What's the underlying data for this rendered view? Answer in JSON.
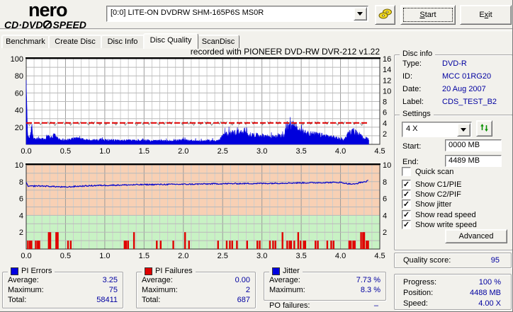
{
  "toolbar": {
    "logo_top": "nero",
    "logo_bottom_left": "CD·DVD",
    "logo_bottom_right": "SPEED",
    "drive": "[0:0]  LITE-ON DVDRW SHM-165P6S MS0R",
    "start_label": "Start",
    "exit_label": "Exit"
  },
  "tabs": {
    "items": [
      "Benchmark",
      "Create Disc",
      "Disc Info",
      "Disc Quality",
      "ScanDisc"
    ],
    "active_index": 3
  },
  "disc_info": {
    "title": "Disc info",
    "rows": [
      {
        "label": "Type:",
        "value": "DVD-R"
      },
      {
        "label": "ID:",
        "value": "MCC 01RG20"
      },
      {
        "label": "Date:",
        "value": "20 Aug 2007"
      },
      {
        "label": "Label:",
        "value": "CDS_TEST_B2"
      }
    ]
  },
  "settings": {
    "title": "Settings",
    "speed_value": "4 X",
    "start_label": "Start:",
    "start_value": "0000 MB",
    "end_label": "End:",
    "end_value": "4489 MB",
    "checkboxes": [
      {
        "label": "Quick scan",
        "checked": false
      },
      {
        "label": "Show C1/PIE",
        "checked": true
      },
      {
        "label": "Show C2/PIF",
        "checked": true
      },
      {
        "label": "Show jitter",
        "checked": true
      },
      {
        "label": "Show read speed",
        "checked": true
      },
      {
        "label": "Show write speed",
        "checked": true
      }
    ],
    "advanced_label": "Advanced"
  },
  "quality": {
    "label": "Quality score:",
    "value": "95"
  },
  "progress": {
    "rows": [
      {
        "label": "Progress:",
        "value": "100 %"
      },
      {
        "label": "Position:",
        "value": "4488 MB"
      },
      {
        "label": "Speed:",
        "value": "4.00 X"
      }
    ]
  },
  "stats": {
    "pi_errors": {
      "title": "PI Errors",
      "color": "#0000e0",
      "rows": [
        {
          "label": "Average:",
          "value": "3.25"
        },
        {
          "label": "Maximum:",
          "value": "75"
        },
        {
          "label": "Total:",
          "value": "58411"
        }
      ]
    },
    "pi_failures": {
      "title": "PI Failures",
      "color": "#e00000",
      "rows": [
        {
          "label": "Average:",
          "value": "0.00"
        },
        {
          "label": "Maximum:",
          "value": "2"
        },
        {
          "label": "Total:",
          "value": "687"
        }
      ]
    },
    "jitter": {
      "title": "Jitter",
      "color": "#0000e0",
      "rows": [
        {
          "label": "Average:",
          "value": "7.73 %"
        },
        {
          "label": "Maximum:",
          "value": "8.3 %"
        }
      ]
    },
    "po_failures": {
      "label": "PO failures:",
      "value": "–"
    }
  },
  "chart_data": [
    {
      "type": "area",
      "title": "recorded with PIONEER DVD-RW  DVR-212  v1.22",
      "x": {
        "min": 0,
        "max": 4.5,
        "ticks": [
          "0.0",
          "0.5",
          "1.0",
          "1.5",
          "2.0",
          "2.5",
          "3.0",
          "3.5",
          "4.0",
          "4.5"
        ],
        "minor_step": 0.1,
        "data_end": 4.36
      },
      "y_left": {
        "label": "PI Errors",
        "min": 0,
        "max": 100,
        "ticks": [
          "100",
          "80",
          "60",
          "40",
          "20"
        ],
        "grid_step": 10
      },
      "y_right": {
        "label": "Speed (X)",
        "min": 0,
        "max": 16,
        "ticks": [
          "16",
          "14",
          "12",
          "10",
          "8",
          "6",
          "4",
          "2"
        ]
      },
      "series": [
        {
          "name": "PI Errors",
          "style": "filled-noise",
          "color": "#0000dc",
          "axis": "left",
          "anchors": [
            [
              0,
              75
            ],
            [
              0.01,
              40
            ],
            [
              0.02,
              9
            ],
            [
              0.05,
              8
            ],
            [
              0.07,
              24
            ],
            [
              0.09,
              8
            ],
            [
              0.15,
              6
            ],
            [
              0.25,
              6
            ],
            [
              0.28,
              13
            ],
            [
              0.31,
              7
            ],
            [
              0.36,
              11
            ],
            [
              0.4,
              6
            ],
            [
              0.5,
              5
            ],
            [
              0.65,
              7
            ],
            [
              0.8,
              5
            ],
            [
              1.0,
              5
            ],
            [
              1.2,
              4.5
            ],
            [
              1.5,
              4.5
            ],
            [
              1.8,
              4
            ],
            [
              2.0,
              5
            ],
            [
              2.2,
              4
            ],
            [
              2.45,
              4.5
            ],
            [
              2.52,
              11
            ],
            [
              2.6,
              13
            ],
            [
              2.7,
              14
            ],
            [
              2.85,
              11
            ],
            [
              3.0,
              10
            ],
            [
              3.15,
              8.5
            ],
            [
              3.28,
              10
            ],
            [
              3.32,
              20
            ],
            [
              3.38,
              23
            ],
            [
              3.45,
              18
            ],
            [
              3.55,
              13
            ],
            [
              3.65,
              12
            ],
            [
              3.8,
              10
            ],
            [
              3.95,
              7.5
            ],
            [
              4.05,
              5
            ],
            [
              4.1,
              13
            ],
            [
              4.17,
              15
            ],
            [
              4.22,
              12
            ],
            [
              4.28,
              8
            ],
            [
              4.33,
              7
            ],
            [
              4.36,
              6
            ]
          ]
        },
        {
          "name": "Write Speed",
          "style": "dashed-line",
          "color": "#e00000",
          "axis": "right",
          "value": 4.0
        },
        {
          "name": "Read Speed",
          "style": "markers",
          "color": "#8a8a8a",
          "axis": "right",
          "value": 3.9
        }
      ]
    },
    {
      "type": "line+bar",
      "x": {
        "min": 0,
        "max": 4.5,
        "ticks": [
          "0.0",
          "0.5",
          "1.0",
          "1.5",
          "2.0",
          "2.5",
          "3.0",
          "3.5",
          "4.0",
          "4.5"
        ],
        "minor_step": 0.1,
        "data_end": 4.36
      },
      "y_left": {
        "min": 0,
        "max": 10,
        "ticks": [
          "10",
          "8",
          "6",
          "4",
          "2"
        ],
        "grid_step": 1
      },
      "y_right": {
        "min": 0,
        "max": 10,
        "ticks": [
          "10",
          "8",
          "6",
          "4",
          "2"
        ]
      },
      "zones": [
        {
          "from": 4,
          "to": 10,
          "color": "#f8d0b4"
        },
        {
          "from": 0,
          "to": 4,
          "color": "#c8f2c4"
        }
      ],
      "series": [
        {
          "name": "Jitter",
          "style": "line-noise",
          "color": "#0000cc",
          "anchors": [
            [
              0,
              7.9
            ],
            [
              0.02,
              7.45
            ],
            [
              0.15,
              7.5
            ],
            [
              0.3,
              7.45
            ],
            [
              0.5,
              7.35
            ],
            [
              0.65,
              7.45
            ],
            [
              0.9,
              7.55
            ],
            [
              1.2,
              7.6
            ],
            [
              1.5,
              7.65
            ],
            [
              1.8,
              7.68
            ],
            [
              2.1,
              7.7
            ],
            [
              2.4,
              7.75
            ],
            [
              2.8,
              7.78
            ],
            [
              3.1,
              7.8
            ],
            [
              3.4,
              7.85
            ],
            [
              3.7,
              7.88
            ],
            [
              4.0,
              7.92
            ],
            [
              4.1,
              7.75
            ],
            [
              4.18,
              7.7
            ],
            [
              4.25,
              7.9
            ],
            [
              4.32,
              8.0
            ],
            [
              4.36,
              8.15
            ]
          ]
        },
        {
          "name": "PI Failures",
          "style": "bars",
          "color": "#e00000",
          "bars": [
            [
              0.02,
              1
            ],
            [
              0.045,
              1
            ],
            [
              0.065,
              1
            ],
            [
              0.12,
              1
            ],
            [
              0.145,
              1
            ],
            [
              0.165,
              1
            ],
            [
              0.285,
              2
            ],
            [
              0.305,
              2
            ],
            [
              0.38,
              2
            ],
            [
              0.4,
              2
            ],
            [
              0.53,
              1
            ],
            [
              0.565,
              1
            ],
            [
              1.25,
              1
            ],
            [
              1.27,
              1
            ],
            [
              1.295,
              1
            ],
            [
              1.37,
              2
            ],
            [
              1.66,
              1
            ],
            [
              1.71,
              1
            ],
            [
              1.87,
              1
            ],
            [
              2.02,
              2
            ],
            [
              2.07,
              1
            ],
            [
              2.44,
              1
            ],
            [
              2.55,
              1
            ],
            [
              2.59,
              1
            ],
            [
              2.62,
              1
            ],
            [
              2.68,
              1
            ],
            [
              2.81,
              1
            ],
            [
              2.94,
              1
            ],
            [
              2.97,
              1
            ],
            [
              3.1,
              1
            ],
            [
              3.14,
              1
            ],
            [
              3.17,
              1
            ],
            [
              3.26,
              2
            ],
            [
              3.32,
              1
            ],
            [
              3.35,
              1
            ],
            [
              3.37,
              1
            ],
            [
              3.41,
              1
            ],
            [
              3.46,
              2
            ],
            [
              3.49,
              1
            ],
            [
              3.53,
              1
            ],
            [
              3.55,
              1
            ],
            [
              3.68,
              1
            ],
            [
              3.71,
              1
            ],
            [
              3.83,
              1
            ],
            [
              3.88,
              1
            ],
            [
              3.91,
              1
            ],
            [
              4.11,
              1
            ],
            [
              4.13,
              1
            ],
            [
              4.16,
              1
            ],
            [
              4.18,
              1
            ],
            [
              4.26,
              2
            ],
            [
              4.285,
              2
            ],
            [
              4.3,
              2
            ],
            [
              4.33,
              1
            ],
            [
              4.35,
              1
            ]
          ]
        }
      ]
    }
  ]
}
